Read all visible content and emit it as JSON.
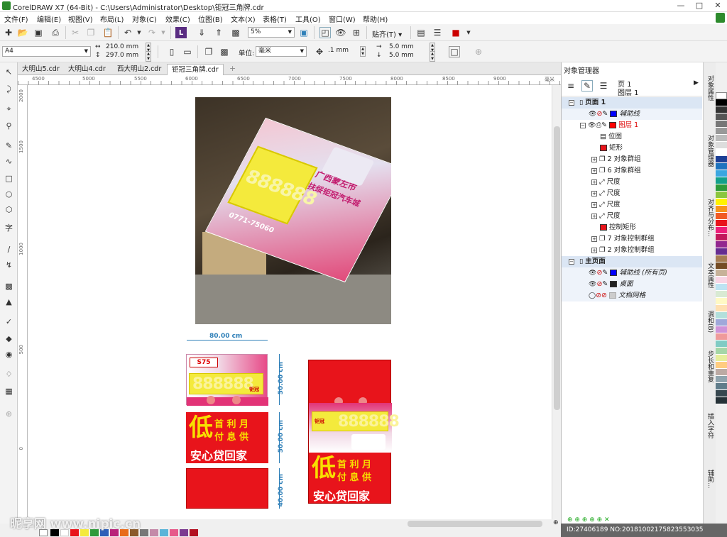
{
  "window": {
    "title": "CorelDRAW X7 (64-Bit) - C:\\Users\\Administrator\\Desktop\\钜冠三角牌.cdr"
  },
  "menu": [
    "文件(F)",
    "编辑(E)",
    "视图(V)",
    "布局(L)",
    "对象(C)",
    "效果(C)",
    "位图(B)",
    "文本(X)",
    "表格(T)",
    "工具(O)",
    "窗口(W)",
    "帮助(H)"
  ],
  "toolbar": {
    "zoom": "5%",
    "snap": "贴齐(T)"
  },
  "propbar": {
    "page_size": "A4",
    "width": "210.0 mm",
    "height": "297.0 mm",
    "units_label": "单位:",
    "units": "毫米",
    "nudge": ".1 mm",
    "dup_x": "5.0 mm",
    "dup_y": "5.0 mm"
  },
  "tabs": [
    "大明山5.cdr",
    "大明山4.cdr",
    "西大明山2.cdr",
    "钜冠三角牌.cdr"
  ],
  "ruler": {
    "h": [
      "4500",
      "5000",
      "5500",
      "6000",
      "6500",
      "7000",
      "7500",
      "8000",
      "8500",
      "9000"
    ],
    "unit": "毫米",
    "v": [
      "2000",
      "1500",
      "1000",
      "500",
      "0"
    ]
  },
  "object_manager": {
    "title": "对象管理器",
    "page_label": "页 1",
    "layer_label": "图层 1",
    "rows": [
      {
        "text": "页面 1",
        "kind": "page"
      },
      {
        "text": "辅助线",
        "kind": "layer",
        "color": "#0000ff"
      },
      {
        "text": "图层 1",
        "kind": "layer",
        "color": "#ff0000"
      },
      {
        "text": "位图",
        "kind": "obj",
        "icon": "bitmap"
      },
      {
        "text": "矩形",
        "kind": "obj",
        "icon": "red"
      },
      {
        "text": "2 对象群组",
        "kind": "grp"
      },
      {
        "text": "6 对象群组",
        "kind": "grp"
      },
      {
        "text": "尺度",
        "kind": "dim"
      },
      {
        "text": "尺度",
        "kind": "dim"
      },
      {
        "text": "尺度",
        "kind": "dim"
      },
      {
        "text": "尺度",
        "kind": "dim"
      },
      {
        "text": "控制矩形",
        "kind": "obj",
        "icon": "red"
      },
      {
        "text": "7 对象控制群组",
        "kind": "grp"
      },
      {
        "text": "2 对象控制群组",
        "kind": "grp"
      },
      {
        "text": "主页面",
        "kind": "page"
      },
      {
        "text": "辅助线 (所有页)",
        "kind": "layer",
        "color": "#0000ff"
      },
      {
        "text": "桌面",
        "kind": "layer",
        "color": "#222222"
      },
      {
        "text": "文档网格",
        "kind": "layer",
        "color": "#cccccc"
      }
    ]
  },
  "dock_tabs": [
    "对象属性",
    "对象管理器",
    "对齐与分布...",
    "文本属性",
    "调和(B)",
    "步长和重复",
    "插入字符",
    "辅助..."
  ],
  "artwork": {
    "photo": {
      "line1": "广西蒙左市",
      "line2": "扶绥钜冠汽车城",
      "digits": "888888",
      "phone": "0771-75060"
    },
    "panel1": {
      "dim_w": "80.00 cm",
      "dim_h": "50.00 cm",
      "digits": "888888",
      "badge": "钜冠"
    },
    "panel2": {
      "big": "低",
      "line1": "首 利 月",
      "line2": "付 息 供",
      "line3": "安心贷回家",
      "dim_h": "50.00 cm"
    },
    "panel3": {
      "dim_h": "40.00 cm"
    },
    "right": {
      "digits": "888888",
      "big": "低",
      "line1": "首 利 月",
      "line2": "付 息 供",
      "line3": "安心贷回家",
      "badge": "钜冠"
    }
  },
  "watermark": {
    "left": "昵享网 www.nipic.cn",
    "right": "ID:27406189 NO:20181002175823553035"
  },
  "colors": {
    "accent": "#2e7fb8",
    "red": "#e8141b",
    "yellow": "#f4ea3c"
  }
}
